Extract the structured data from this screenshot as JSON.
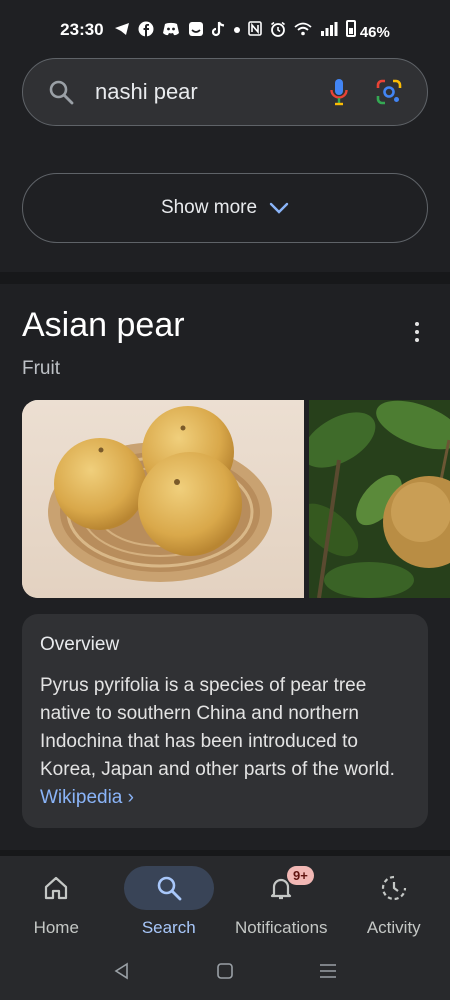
{
  "status_bar": {
    "time": "23:30",
    "battery": "46%",
    "icons": [
      "telegram-icon",
      "facebook-icon",
      "discord-icon",
      "message-icon",
      "tiktok-icon",
      "dot-icon",
      "nfc-icon",
      "alarm-icon",
      "wifi-icon",
      "signal-icon",
      "battery-icon"
    ]
  },
  "search": {
    "query": "nashi pear",
    "icons": [
      "search-icon",
      "mic-icon",
      "lens-icon"
    ]
  },
  "show_more": {
    "label": "Show more"
  },
  "knowledge_panel": {
    "title": "Asian pear",
    "subtitle": "Fruit",
    "overview": {
      "heading": "Overview",
      "text": "Pyrus pyrifolia is a species of pear tree native to southern China and northern Indochina that has been introduced to Korea, Japan and other parts of the world.",
      "link": "Wikipedia",
      "link_chevron": "›"
    }
  },
  "bottom_nav": {
    "items": [
      {
        "label": "Home",
        "icon": "home-icon",
        "active": false
      },
      {
        "label": "Search",
        "icon": "search-icon",
        "active": true
      },
      {
        "label": "Notifications",
        "icon": "bell-icon",
        "active": false,
        "badge": "9+"
      },
      {
        "label": "Activity",
        "icon": "activity-icon",
        "active": false
      }
    ]
  },
  "colors": {
    "background": "#1f2023",
    "surface": "#303134",
    "link": "#8ab4f8",
    "active_nav": "#a8c7fa",
    "badge": "#f2b8b5"
  }
}
